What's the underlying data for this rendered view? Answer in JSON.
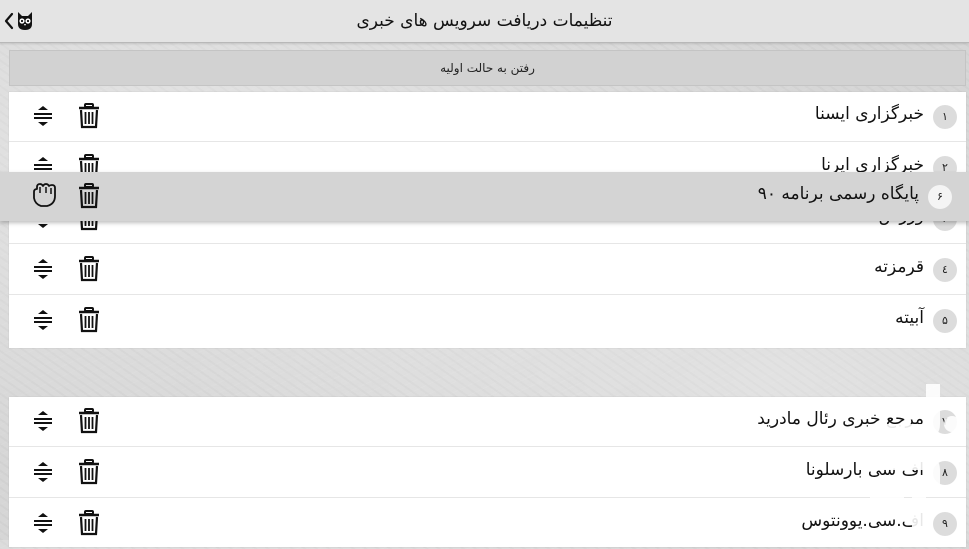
{
  "header": {
    "title": "تنظیمات دریافت سرویس های خبری",
    "back_icon": "chevron-left-icon",
    "app_icon": "owl-icon"
  },
  "reset_button": {
    "label": "رفتن به حالت اولیه"
  },
  "dragging_item": {
    "number": "۶",
    "name": "پایگاه رسمی برنامه ۹۰"
  },
  "group1": {
    "items": [
      {
        "number": "۱",
        "name": "خبرگزاری ایسنا"
      },
      {
        "number": "۲",
        "name": "خبرگزاری ایرنا"
      },
      {
        "number": "۳",
        "name": "ورزش سه"
      },
      {
        "number": "٤",
        "name": "قرمزته"
      },
      {
        "number": "۵",
        "name": "آبیته"
      }
    ]
  },
  "group2": {
    "items": [
      {
        "number": "۷",
        "name": "مرجع خبری رئال مادرید"
      },
      {
        "number": "۸",
        "name": "اف سی بارسلونا"
      },
      {
        "number": "۹",
        "name": "اف.سی.یوونتوس"
      }
    ]
  },
  "icons": {
    "delete": "trash-icon",
    "reorder": "reorder-icon",
    "grab": "grab-hand-icon"
  },
  "colors": {
    "background": "#d6d6d6",
    "header": "#e4e4e4",
    "row": "#ffffff",
    "number_badge": "#dcdcdc",
    "dragged_row": "#d4d4d4"
  }
}
